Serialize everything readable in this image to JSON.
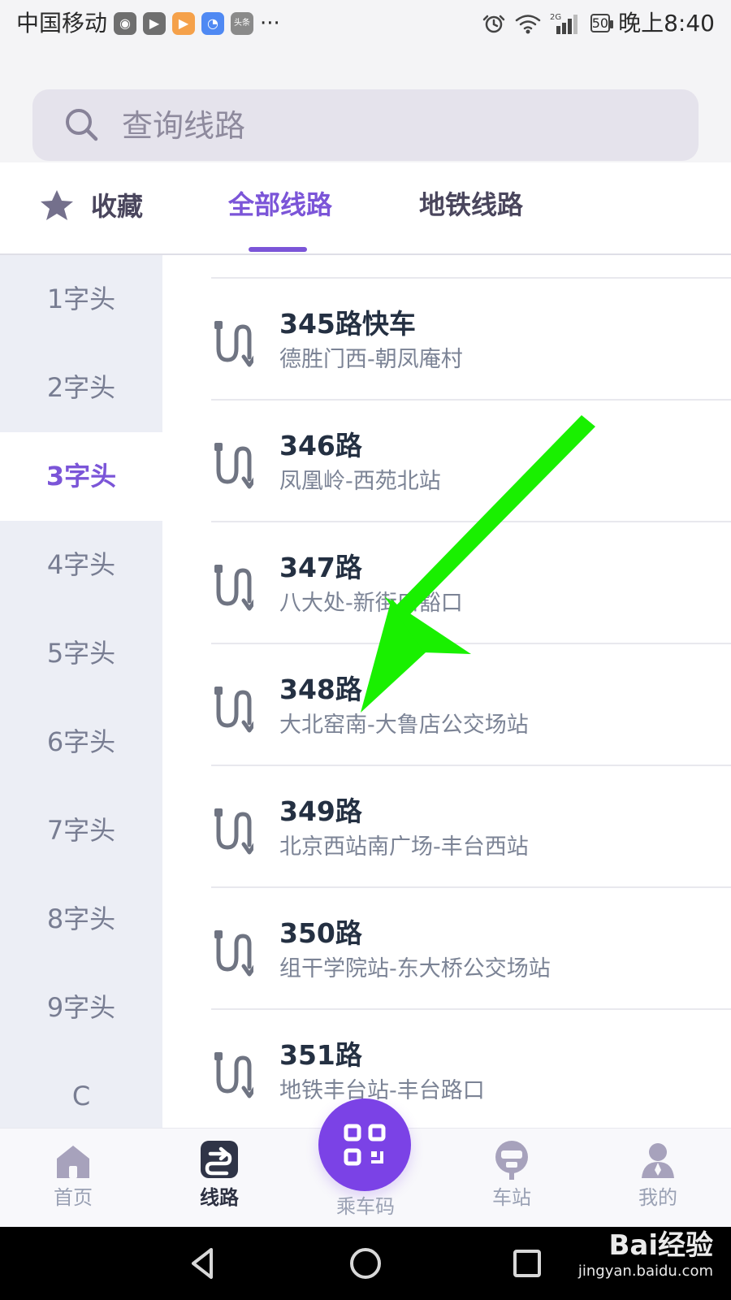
{
  "status_bar": {
    "carrier": "中国移动",
    "app_icons": [
      "media-icon",
      "video-icon",
      "player-icon",
      "map-icon",
      "news-icon"
    ],
    "app_icon_labels": {
      "news": "头条"
    },
    "more": "···",
    "signal": "2G",
    "battery": "50",
    "time": "晚上8:40"
  },
  "search": {
    "placeholder": "查询线路"
  },
  "tabs": {
    "favorites": "收藏",
    "all_routes": "全部线路",
    "subway_routes": "地铁线路"
  },
  "sidebar": {
    "items": [
      "1字头",
      "2字头",
      "3字头",
      "4字头",
      "5字头",
      "6字头",
      "7字头",
      "8字头",
      "9字头",
      "C"
    ],
    "active_index": 2
  },
  "routes": [
    {
      "name": "345路快车",
      "path": "德胜门西-朝凤庵村"
    },
    {
      "name": "346路",
      "path": "凤凰岭-西苑北站"
    },
    {
      "name": "347路",
      "path": "八大处-新街口豁口"
    },
    {
      "name": "348路",
      "path": "大北窑南-大鲁店公交场站"
    },
    {
      "name": "349路",
      "path": "北京西站南广场-丰台西站"
    },
    {
      "name": "350路",
      "path": "组干学院站-东大桥公交场站"
    },
    {
      "name": "351路",
      "path": "地铁丰台站-丰台路口"
    }
  ],
  "bottom_nav": {
    "home": "首页",
    "routes": "线路",
    "qr": "乘车码",
    "stations": "车站",
    "mine": "我的"
  },
  "watermark": {
    "main": "Bai经验",
    "sub": "jingyan.baidu.com"
  },
  "colors": {
    "accent": "#7b55d8",
    "qr_button": "#7b42e6",
    "arrow": "#19f000",
    "sidebar_bg": "#eceef5"
  }
}
